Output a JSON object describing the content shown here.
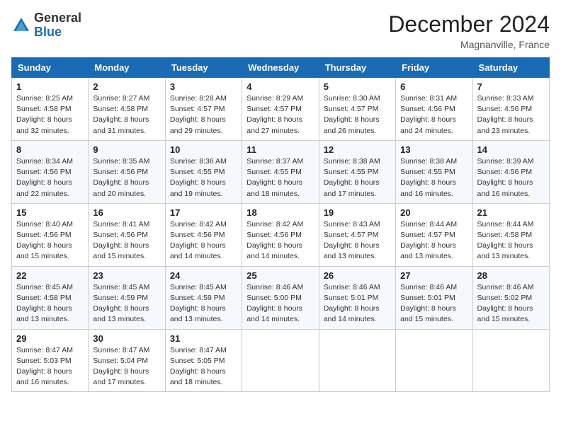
{
  "header": {
    "logo_line1": "General",
    "logo_line2": "Blue",
    "month": "December 2024",
    "location": "Magnanville, France"
  },
  "weekdays": [
    "Sunday",
    "Monday",
    "Tuesday",
    "Wednesday",
    "Thursday",
    "Friday",
    "Saturday"
  ],
  "weeks": [
    [
      {
        "day": "1",
        "sunrise": "Sunrise: 8:25 AM",
        "sunset": "Sunset: 4:58 PM",
        "daylight": "Daylight: 8 hours and 32 minutes."
      },
      {
        "day": "2",
        "sunrise": "Sunrise: 8:27 AM",
        "sunset": "Sunset: 4:58 PM",
        "daylight": "Daylight: 8 hours and 31 minutes."
      },
      {
        "day": "3",
        "sunrise": "Sunrise: 8:28 AM",
        "sunset": "Sunset: 4:57 PM",
        "daylight": "Daylight: 8 hours and 29 minutes."
      },
      {
        "day": "4",
        "sunrise": "Sunrise: 8:29 AM",
        "sunset": "Sunset: 4:57 PM",
        "daylight": "Daylight: 8 hours and 27 minutes."
      },
      {
        "day": "5",
        "sunrise": "Sunrise: 8:30 AM",
        "sunset": "Sunset: 4:57 PM",
        "daylight": "Daylight: 8 hours and 26 minutes."
      },
      {
        "day": "6",
        "sunrise": "Sunrise: 8:31 AM",
        "sunset": "Sunset: 4:56 PM",
        "daylight": "Daylight: 8 hours and 24 minutes."
      },
      {
        "day": "7",
        "sunrise": "Sunrise: 8:33 AM",
        "sunset": "Sunset: 4:56 PM",
        "daylight": "Daylight: 8 hours and 23 minutes."
      }
    ],
    [
      {
        "day": "8",
        "sunrise": "Sunrise: 8:34 AM",
        "sunset": "Sunset: 4:56 PM",
        "daylight": "Daylight: 8 hours and 22 minutes."
      },
      {
        "day": "9",
        "sunrise": "Sunrise: 8:35 AM",
        "sunset": "Sunset: 4:56 PM",
        "daylight": "Daylight: 8 hours and 20 minutes."
      },
      {
        "day": "10",
        "sunrise": "Sunrise: 8:36 AM",
        "sunset": "Sunset: 4:55 PM",
        "daylight": "Daylight: 8 hours and 19 minutes."
      },
      {
        "day": "11",
        "sunrise": "Sunrise: 8:37 AM",
        "sunset": "Sunset: 4:55 PM",
        "daylight": "Daylight: 8 hours and 18 minutes."
      },
      {
        "day": "12",
        "sunrise": "Sunrise: 8:38 AM",
        "sunset": "Sunset: 4:55 PM",
        "daylight": "Daylight: 8 hours and 17 minutes."
      },
      {
        "day": "13",
        "sunrise": "Sunrise: 8:38 AM",
        "sunset": "Sunset: 4:55 PM",
        "daylight": "Daylight: 8 hours and 16 minutes."
      },
      {
        "day": "14",
        "sunrise": "Sunrise: 8:39 AM",
        "sunset": "Sunset: 4:56 PM",
        "daylight": "Daylight: 8 hours and 16 minutes."
      }
    ],
    [
      {
        "day": "15",
        "sunrise": "Sunrise: 8:40 AM",
        "sunset": "Sunset: 4:56 PM",
        "daylight": "Daylight: 8 hours and 15 minutes."
      },
      {
        "day": "16",
        "sunrise": "Sunrise: 8:41 AM",
        "sunset": "Sunset: 4:56 PM",
        "daylight": "Daylight: 8 hours and 15 minutes."
      },
      {
        "day": "17",
        "sunrise": "Sunrise: 8:42 AM",
        "sunset": "Sunset: 4:56 PM",
        "daylight": "Daylight: 8 hours and 14 minutes."
      },
      {
        "day": "18",
        "sunrise": "Sunrise: 8:42 AM",
        "sunset": "Sunset: 4:56 PM",
        "daylight": "Daylight: 8 hours and 14 minutes."
      },
      {
        "day": "19",
        "sunrise": "Sunrise: 8:43 AM",
        "sunset": "Sunset: 4:57 PM",
        "daylight": "Daylight: 8 hours and 13 minutes."
      },
      {
        "day": "20",
        "sunrise": "Sunrise: 8:44 AM",
        "sunset": "Sunset: 4:57 PM",
        "daylight": "Daylight: 8 hours and 13 minutes."
      },
      {
        "day": "21",
        "sunrise": "Sunrise: 8:44 AM",
        "sunset": "Sunset: 4:58 PM",
        "daylight": "Daylight: 8 hours and 13 minutes."
      }
    ],
    [
      {
        "day": "22",
        "sunrise": "Sunrise: 8:45 AM",
        "sunset": "Sunset: 4:58 PM",
        "daylight": "Daylight: 8 hours and 13 minutes."
      },
      {
        "day": "23",
        "sunrise": "Sunrise: 8:45 AM",
        "sunset": "Sunset: 4:59 PM",
        "daylight": "Daylight: 8 hours and 13 minutes."
      },
      {
        "day": "24",
        "sunrise": "Sunrise: 8:45 AM",
        "sunset": "Sunset: 4:59 PM",
        "daylight": "Daylight: 8 hours and 13 minutes."
      },
      {
        "day": "25",
        "sunrise": "Sunrise: 8:46 AM",
        "sunset": "Sunset: 5:00 PM",
        "daylight": "Daylight: 8 hours and 14 minutes."
      },
      {
        "day": "26",
        "sunrise": "Sunrise: 8:46 AM",
        "sunset": "Sunset: 5:01 PM",
        "daylight": "Daylight: 8 hours and 14 minutes."
      },
      {
        "day": "27",
        "sunrise": "Sunrise: 8:46 AM",
        "sunset": "Sunset: 5:01 PM",
        "daylight": "Daylight: 8 hours and 15 minutes."
      },
      {
        "day": "28",
        "sunrise": "Sunrise: 8:46 AM",
        "sunset": "Sunset: 5:02 PM",
        "daylight": "Daylight: 8 hours and 15 minutes."
      }
    ],
    [
      {
        "day": "29",
        "sunrise": "Sunrise: 8:47 AM",
        "sunset": "Sunset: 5:03 PM",
        "daylight": "Daylight: 8 hours and 16 minutes."
      },
      {
        "day": "30",
        "sunrise": "Sunrise: 8:47 AM",
        "sunset": "Sunset: 5:04 PM",
        "daylight": "Daylight: 8 hours and 17 minutes."
      },
      {
        "day": "31",
        "sunrise": "Sunrise: 8:47 AM",
        "sunset": "Sunset: 5:05 PM",
        "daylight": "Daylight: 8 hours and 18 minutes."
      },
      null,
      null,
      null,
      null
    ]
  ]
}
